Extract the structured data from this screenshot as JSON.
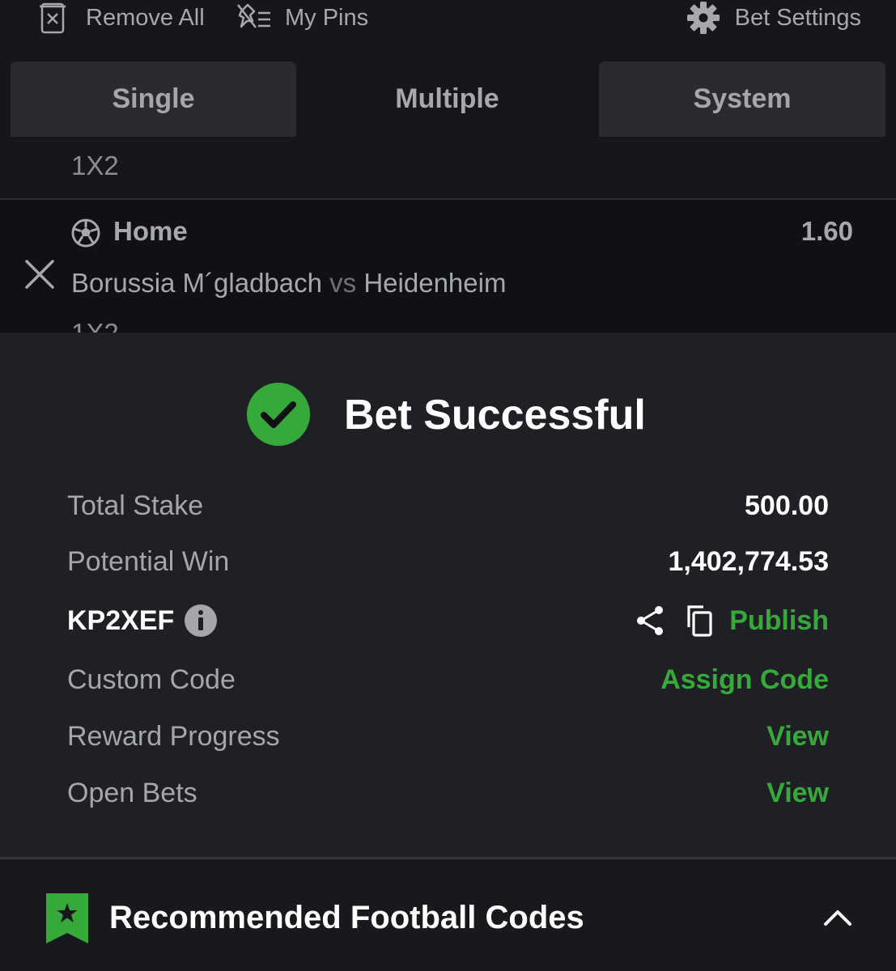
{
  "toolbar": {
    "remove_all": "Remove All",
    "my_pins": "My Pins",
    "bet_settings": "Bet Settings"
  },
  "tabs": [
    {
      "label": "Single"
    },
    {
      "label": "Multiple"
    },
    {
      "label": "System"
    }
  ],
  "bet_list": {
    "previous_market": "1X2",
    "selection": {
      "pick": "Home",
      "odds": "1.60",
      "home_team": "Borussia M´gladbach",
      "vs": "vs",
      "away_team": "Heidenheim",
      "market": "1X2"
    }
  },
  "success": {
    "title": "Bet Successful",
    "rows": {
      "total_stake": {
        "label": "Total Stake",
        "value": "500.00"
      },
      "potential_win": {
        "label": "Potential Win",
        "value": "1,402,774.53"
      },
      "booking": {
        "code": "KP2XEF",
        "publish": "Publish"
      },
      "custom_code": {
        "label": "Custom Code",
        "action": "Assign Code"
      },
      "reward_progress": {
        "label": "Reward Progress",
        "action": "View"
      },
      "open_bets": {
        "label": "Open Bets",
        "action": "View"
      }
    }
  },
  "recommended": {
    "title": "Recommended Football Codes"
  },
  "colors": {
    "accent_green": "#37a93b",
    "background": "#16171b",
    "sheet": "#1f2025"
  },
  "icons": [
    "trash-x-icon",
    "pin-list-icon",
    "gear-icon",
    "close-icon",
    "football-icon",
    "check-circle-icon",
    "info-icon",
    "share-icon",
    "copy-icon",
    "bookmark-star-icon",
    "chevron-up-icon"
  ]
}
